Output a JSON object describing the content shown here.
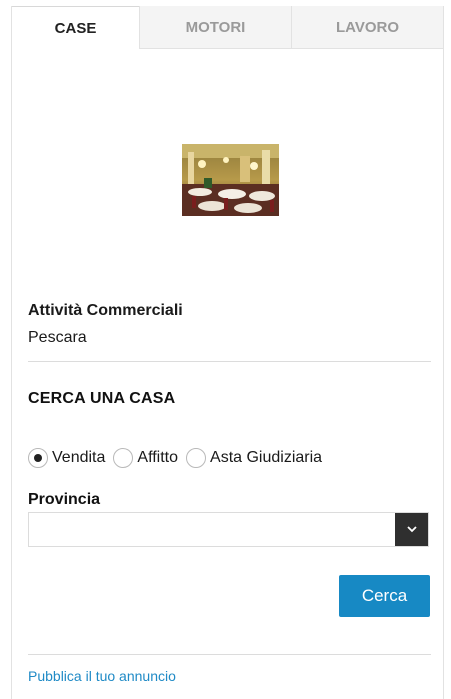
{
  "tabs": [
    {
      "label": "CASE",
      "active": true
    },
    {
      "label": "MOTORI",
      "active": false
    },
    {
      "label": "LAVORO",
      "active": false
    }
  ],
  "listing": {
    "image": "restaurant-interior-photo",
    "title": "Attività Commerciali",
    "location": "Pescara"
  },
  "search": {
    "title": "CERCA UNA CASA",
    "options": [
      {
        "label": "Vendita",
        "checked": true
      },
      {
        "label": "Affitto",
        "checked": false
      },
      {
        "label": "Asta Giudiziaria",
        "checked": false
      }
    ],
    "province_label": "Provincia",
    "province_value": "",
    "submit_label": "Cerca"
  },
  "footer": {
    "link_label": "Pubblica il tuo annuncio"
  },
  "colors": {
    "accent": "#1789c4",
    "link": "#1f8ac6",
    "caret_bg": "#2f2f2f"
  }
}
